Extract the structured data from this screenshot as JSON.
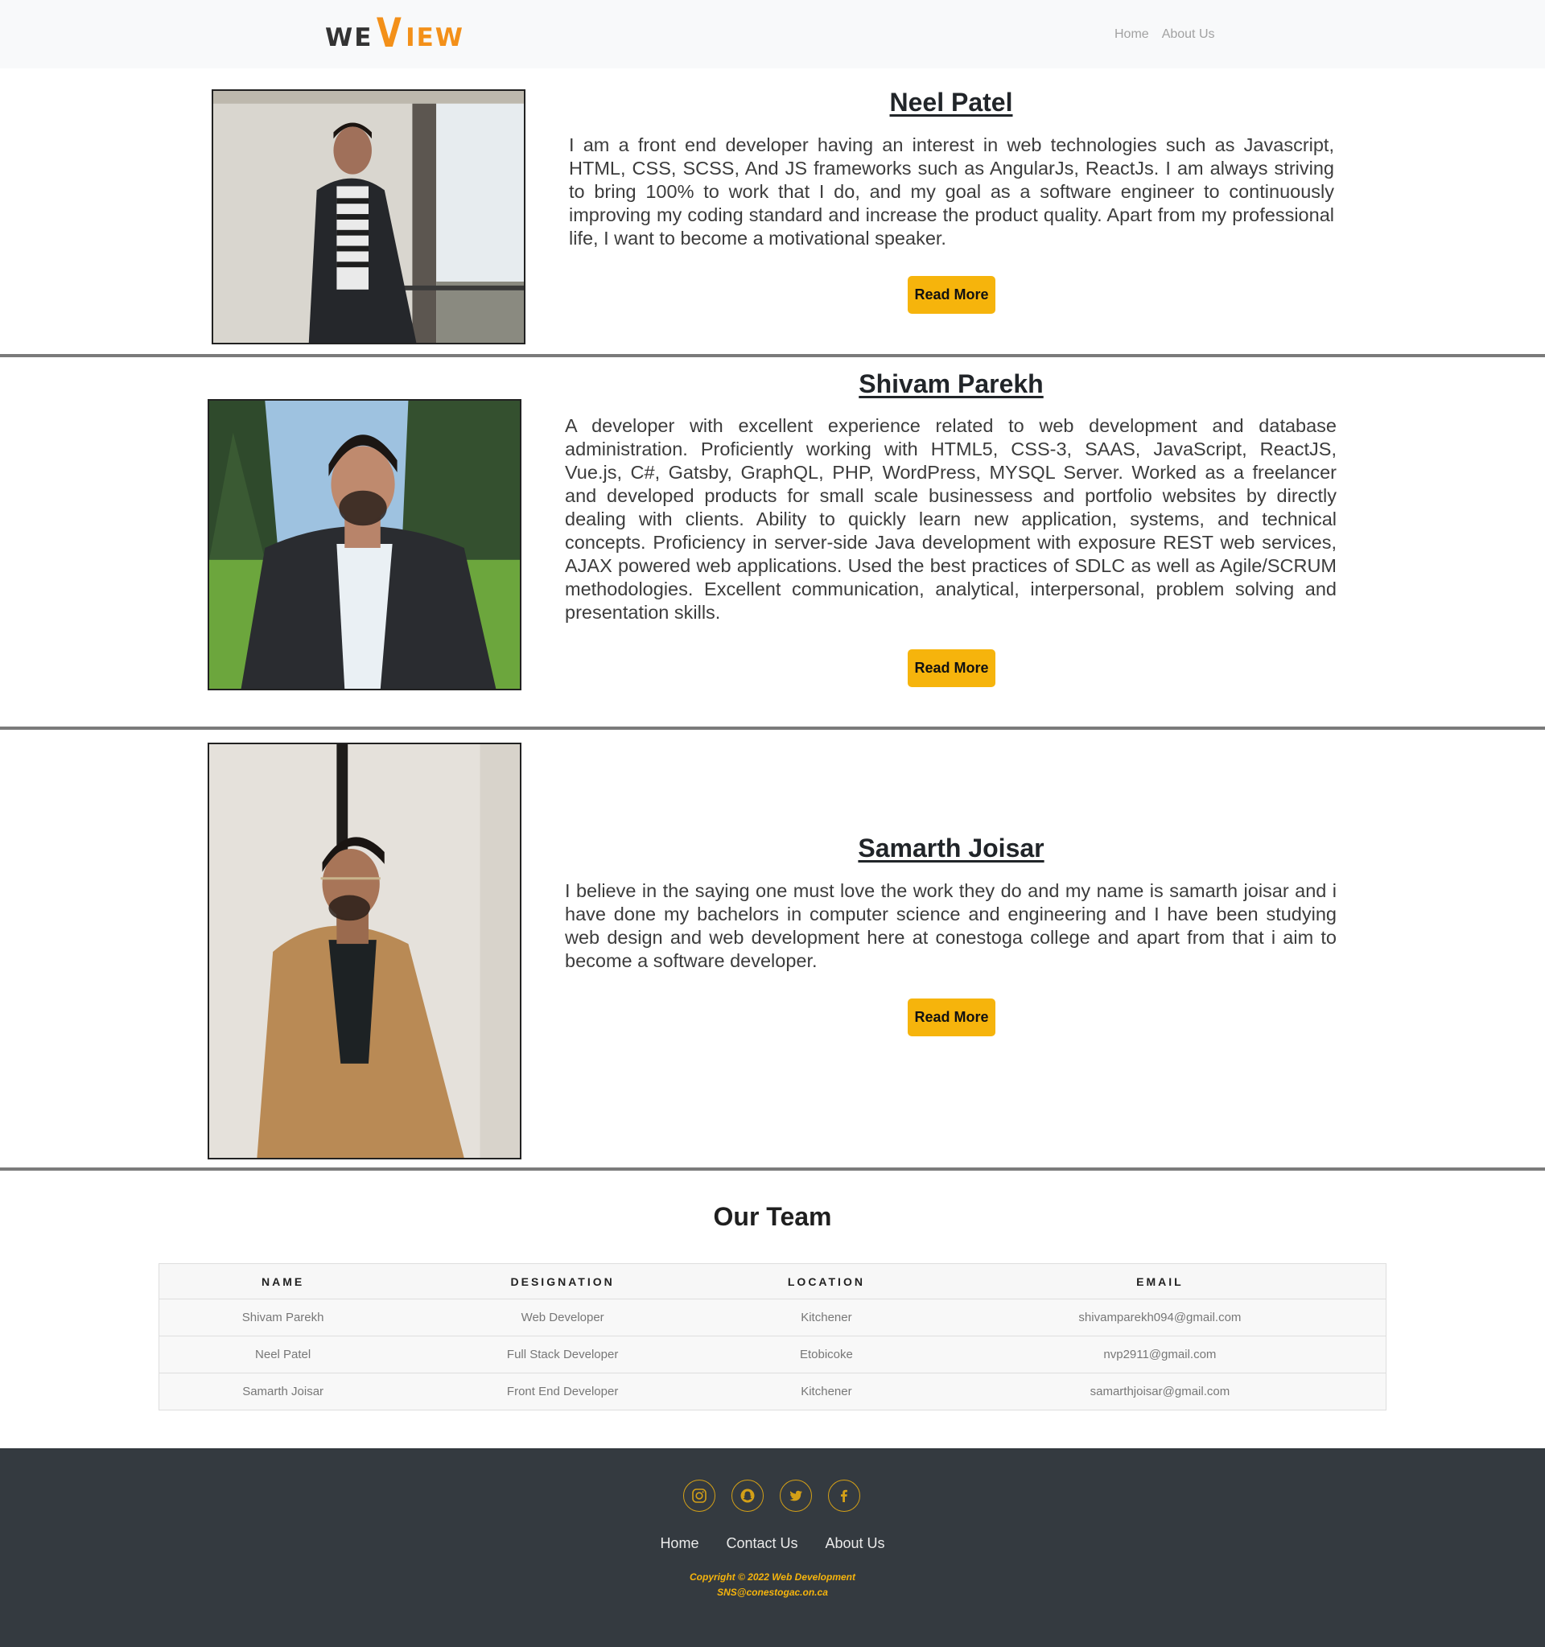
{
  "header": {
    "logo": {
      "part1": "WE",
      "part2": "V",
      "part3": "IEW"
    },
    "nav": [
      "Home",
      "About Us"
    ]
  },
  "profiles": [
    {
      "name": "Neel Patel",
      "bio": "I am a front end developer having an interest in web technologies such as Javascript, HTML, CSS, SCSS, And JS frameworks such as AngularJs, ReactJs. I am always striving to bring 100% to work that I do, and my goal as a software engineer to continuously improving my coding standard and increase the product quality. Apart from my professional life, I want to become a motivational speaker.",
      "button": "Read More"
    },
    {
      "name": "Shivam Parekh",
      "bio": "A developer with excellent experience related to web development and database administration. Proficiently working with HTML5, CSS-3, SAAS, JavaScript, ReactJS, Vue.js, C#, Gatsby, GraphQL, PHP, WordPress, MYSQL Server. Worked as a freelancer and developed products for small scale businessess and portfolio websites by directly dealing with clients. Ability to quickly learn new application, systems, and technical concepts. Proficiency in server-side Java development with exposure REST web services, AJAX powered web applications. Used the best practices of SDLC as well as Agile/SCRUM methodologies. Excellent communication, analytical, interpersonal, problem solving and presentation skills.",
      "button": "Read More"
    },
    {
      "name": "Samarth Joisar",
      "bio": "I believe in the saying one must love the work they do and my name is samarth joisar and i have done my bachelors in computer science and engineering and I have been studying web design and web development here at conestoga college and apart from that i aim to become a software developer.",
      "button": "Read More"
    }
  ],
  "team": {
    "title": "Our Team",
    "columns": [
      "NAME",
      "DESIGNATION",
      "LOCATION",
      "EMAIL"
    ],
    "rows": [
      [
        "Shivam Parekh",
        "Web Developer",
        "Kitchener",
        "shivamparekh094@gmail.com"
      ],
      [
        "Neel Patel",
        "Full Stack Developer",
        "Etobicoke",
        "nvp2911@gmail.com"
      ],
      [
        "Samarth Joisar",
        "Front End Developer",
        "Kitchener",
        "samarthjoisar@gmail.com"
      ]
    ]
  },
  "footer": {
    "social_icons": [
      "instagram-icon",
      "snapchat-icon",
      "twitter-icon",
      "facebook-icon"
    ],
    "links": [
      "Home",
      "Contact Us",
      "About Us"
    ],
    "copyright": "Copyright © 2022 Web Development",
    "email": "SNS@conestogac.on.ca"
  },
  "colors": {
    "accent": "#f6b40c",
    "logo_orange": "#f39019",
    "footer_bg": "#343a40",
    "divider": "#7b7b7b"
  }
}
